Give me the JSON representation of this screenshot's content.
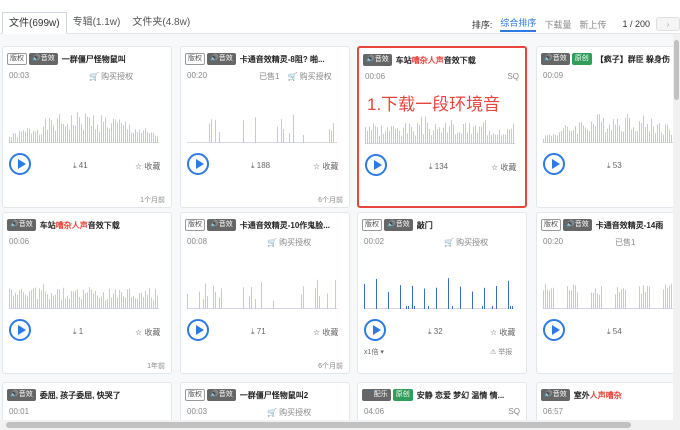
{
  "tabs": [
    {
      "label": "文件(699w)",
      "active": true
    },
    {
      "label": "专辑(1.1w)",
      "active": false
    },
    {
      "label": "文件夹(4.8w)",
      "active": false
    }
  ],
  "sort": {
    "label": "排序:",
    "options": [
      {
        "label": "综合排序",
        "active": true
      },
      {
        "label": "下载量",
        "active": false
      },
      {
        "label": "新上传",
        "active": false
      }
    ],
    "page": "1 / 200",
    "next": "›"
  },
  "annotation": "1.下载一段环境音",
  "cards": [
    {
      "badges": [
        {
          "t": "版权",
          "s": "plain"
        },
        {
          "t": "🔊音效",
          "s": "dark"
        }
      ],
      "title": [
        {
          "t": "一群僵尸怪物鼠叫",
          "red": false
        }
      ],
      "duration": "00:03",
      "sold": "",
      "buy": "🛒 购买授权",
      "sq": "",
      "downloads": "41",
      "fav": "☆ 收藏",
      "age": "1个月前",
      "extra": "",
      "report": "",
      "wave": {
        "style": "dense",
        "seed": 1
      },
      "highlight": false
    },
    {
      "badges": [
        {
          "t": "版权",
          "s": "plain"
        },
        {
          "t": "🔊音效",
          "s": "dark"
        }
      ],
      "title": [
        {
          "t": "卡通音效精灵-8阻? 啪...",
          "red": false
        }
      ],
      "duration": "00:20",
      "sold": "已售1",
      "buy": "🛒 购买授权",
      "sq": "",
      "downloads": "188",
      "fav": "☆ 收藏",
      "age": "6个月前",
      "extra": "",
      "report": "",
      "wave": {
        "style": "sparse",
        "seed": 2
      },
      "highlight": false
    },
    {
      "badges": [
        {
          "t": "🔊音效",
          "s": "dark"
        }
      ],
      "title": [
        {
          "t": "车站",
          "red": false
        },
        {
          "t": "嘈杂人声",
          "red": true
        },
        {
          "t": "音效下载",
          "red": false
        }
      ],
      "duration": "00:06",
      "sold": "",
      "buy": "",
      "sq": "SQ",
      "downloads": "134",
      "fav": "☆ 收藏",
      "age": "",
      "extra": "",
      "report": "",
      "wave": {
        "style": "dense-flat",
        "seed": 3
      },
      "highlight": true
    },
    {
      "badges": [
        {
          "t": "🔊音效",
          "s": "dark"
        },
        {
          "t": "原创",
          "s": "green"
        }
      ],
      "title": [
        {
          "t": "【疯子】群臣 躲身伤",
          "red": false
        }
      ],
      "duration": "00:09",
      "sold": "",
      "buy": "",
      "sq": "",
      "downloads": "53",
      "fav": "",
      "age": "",
      "extra": "",
      "report": "",
      "wave": {
        "style": "dense",
        "seed": 4
      },
      "highlight": false
    },
    {
      "badges": [
        {
          "t": "🔊音效",
          "s": "dark"
        }
      ],
      "title": [
        {
          "t": "车站",
          "red": false
        },
        {
          "t": "嘈杂人声",
          "red": true
        },
        {
          "t": "音效下载",
          "red": false
        }
      ],
      "duration": "00:06",
      "sold": "",
      "buy": "",
      "sq": "",
      "downloads": "1",
      "fav": "☆ 收藏",
      "age": "1年前",
      "extra": "",
      "report": "",
      "wave": {
        "style": "dense-flat",
        "seed": 5
      },
      "highlight": false
    },
    {
      "badges": [
        {
          "t": "版权",
          "s": "plain"
        },
        {
          "t": "🔊音效",
          "s": "dark"
        }
      ],
      "title": [
        {
          "t": "卡通音效精灵-10作鬼脸...",
          "red": false
        }
      ],
      "duration": "00:08",
      "sold": "",
      "buy": "🛒 购买授权",
      "sq": "",
      "downloads": "71",
      "fav": "☆ 收藏",
      "age": "6个月前",
      "extra": "",
      "report": "",
      "wave": {
        "style": "sparse",
        "seed": 6
      },
      "highlight": false
    },
    {
      "badges": [
        {
          "t": "版权",
          "s": "plain"
        },
        {
          "t": "🔊音效",
          "s": "dark"
        }
      ],
      "title": [
        {
          "t": "敲门",
          "red": false
        }
      ],
      "duration": "00:02",
      "sold": "",
      "buy": "🛒 购买授权",
      "sq": "",
      "downloads": "32",
      "fav": "☆ 收藏",
      "age": "",
      "extra": "x1倍 ▾",
      "report": "⚠ 举报",
      "wave": {
        "style": "knock",
        "seed": 7
      },
      "highlight": false
    },
    {
      "badges": [
        {
          "t": "版权",
          "s": "plain"
        },
        {
          "t": "🔊音效",
          "s": "dark"
        }
      ],
      "title": [
        {
          "t": "卡通音效精灵-14雨",
          "red": false
        }
      ],
      "duration": "00:20",
      "sold": "已售1",
      "buy": "",
      "sq": "",
      "downloads": "54",
      "fav": "",
      "age": "",
      "extra": "",
      "report": "",
      "wave": {
        "style": "blocks",
        "seed": 8
      },
      "highlight": false
    },
    {
      "badges": [
        {
          "t": "🔊音效",
          "s": "dark"
        }
      ],
      "title": [
        {
          "t": "委屈, 孩子委屈, 快哭了",
          "red": false
        }
      ],
      "duration": "00:01",
      "sold": "",
      "buy": "",
      "sq": "",
      "downloads": "",
      "fav": "",
      "age": "",
      "extra": "",
      "report": "",
      "wave": {
        "style": "none",
        "seed": 9
      },
      "highlight": false
    },
    {
      "badges": [
        {
          "t": "版权",
          "s": "plain"
        },
        {
          "t": "🔊音效",
          "s": "dark"
        }
      ],
      "title": [
        {
          "t": "一群僵尸怪物鼠叫2",
          "red": false
        }
      ],
      "duration": "00:03",
      "sold": "",
      "buy": "🛒 购买授权",
      "sq": "",
      "downloads": "",
      "fav": "",
      "age": "",
      "extra": "",
      "report": "",
      "wave": {
        "style": "none",
        "seed": 10
      },
      "highlight": false
    },
    {
      "badges": [
        {
          "t": "🎵配乐",
          "s": "dark"
        },
        {
          "t": "原创",
          "s": "green"
        }
      ],
      "title": [
        {
          "t": "安静 恋爱 梦幻 温情 情...",
          "red": false
        }
      ],
      "duration": "04:06",
      "sold": "",
      "buy": "",
      "sq": "SQ",
      "downloads": "",
      "fav": "",
      "age": "",
      "extra": "",
      "report": "",
      "wave": {
        "style": "none",
        "seed": 11
      },
      "highlight": false
    },
    {
      "badges": [
        {
          "t": "🔊音效",
          "s": "dark"
        }
      ],
      "title": [
        {
          "t": "室外",
          "red": false
        },
        {
          "t": "人声嘈杂",
          "red": true
        }
      ],
      "duration": "06:57",
      "sold": "",
      "buy": "",
      "sq": "",
      "downloads": "",
      "fav": "",
      "age": "",
      "extra": "",
      "report": "",
      "wave": {
        "style": "none",
        "seed": 12
      },
      "highlight": false
    }
  ],
  "colors": {
    "accent": "#2c7be5",
    "highlight": "#e8453c",
    "wave": "#c8c8dc",
    "wave_played": "#3a6fc4"
  }
}
